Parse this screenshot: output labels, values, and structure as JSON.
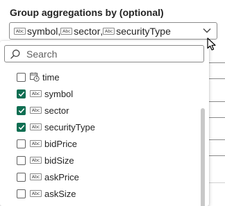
{
  "field": {
    "label": "Group aggregations by (optional)",
    "selected": [
      {
        "name": "symbol",
        "sep": ","
      },
      {
        "name": "sector",
        "sep": ","
      },
      {
        "name": "securityType",
        "sep": ""
      }
    ]
  },
  "dropdown": {
    "search_placeholder": "Search",
    "items": [
      {
        "label": "time",
        "type": "datetime",
        "checked": false
      },
      {
        "label": "symbol",
        "type": "text",
        "checked": true
      },
      {
        "label": "sector",
        "type": "text",
        "checked": true
      },
      {
        "label": "securityType",
        "type": "text",
        "checked": true
      },
      {
        "label": "bidPrice",
        "type": "text",
        "checked": false
      },
      {
        "label": "bidSize",
        "type": "text",
        "checked": false
      },
      {
        "label": "askPrice",
        "type": "text",
        "checked": false
      },
      {
        "label": "askSize",
        "type": "text",
        "checked": false
      }
    ]
  },
  "icons": {
    "text_type": "abc-text-type-icon",
    "datetime_type": "calendar-clock-icon",
    "search": "search-icon",
    "chevron": "chevron-down-icon",
    "cursor": "mouse-pointer-icon"
  },
  "colors": {
    "checkbox_checked": "#0f6e52",
    "border": "#8a8a8a",
    "text": "#242424"
  }
}
